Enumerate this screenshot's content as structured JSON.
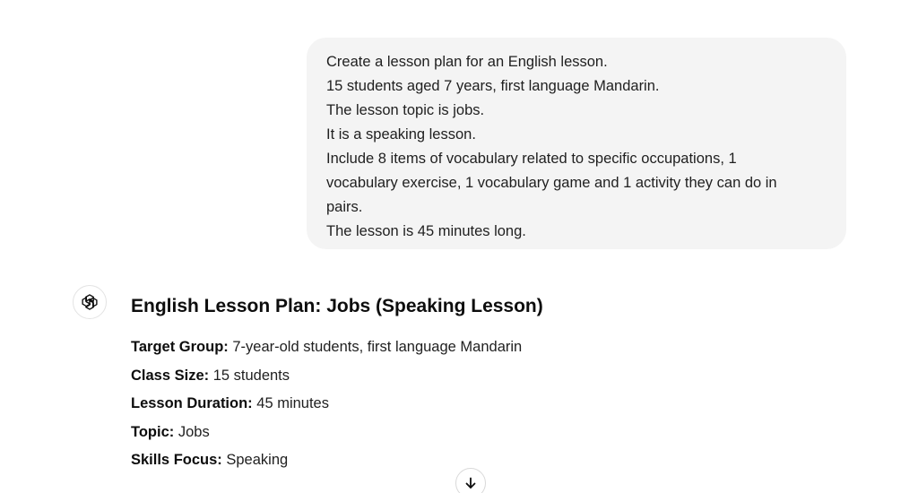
{
  "user_message": {
    "lines": [
      "Create a lesson plan for an English lesson.",
      "15 students aged 7 years, first language Mandarin.",
      "The lesson topic is jobs.",
      "It is a speaking lesson.",
      "Include 8 items of vocabulary related to specific occupations, 1",
      "vocabulary exercise, 1 vocabulary game and 1 activity they can do in",
      "pairs.",
      "The lesson is 45 minutes long."
    ]
  },
  "assistant_message": {
    "avatar_icon": "openai-logo-icon",
    "title": "English Lesson Plan: Jobs (Speaking Lesson)",
    "details": [
      {
        "label": "Target Group:",
        "value": " 7-year-old students, first language Mandarin"
      },
      {
        "label": "Class Size:",
        "value": " 15 students"
      },
      {
        "label": "Lesson Duration:",
        "value": " 45 minutes"
      },
      {
        "label": "Topic:",
        "value": " Jobs"
      },
      {
        "label": "Skills Focus:",
        "value": " Speaking"
      }
    ]
  },
  "scroll_button": {
    "icon": "arrow-down-icon"
  }
}
